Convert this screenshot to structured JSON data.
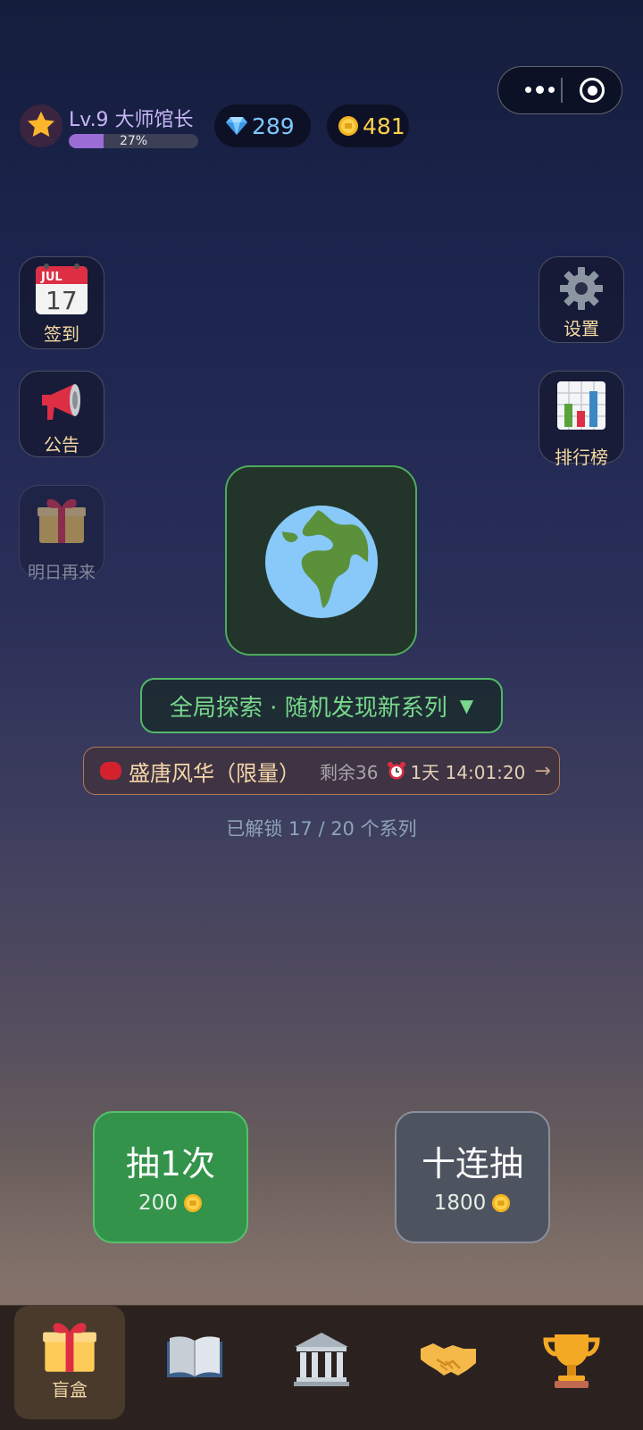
{
  "header": {
    "level_text": "Lv.9 大师馆长",
    "xp_percent_text": "27%",
    "xp_fraction": 0.27,
    "gems": "289",
    "coins": "481"
  },
  "side_left": [
    {
      "label": "签到",
      "icon": "calendar-icon",
      "calendar_month": "JUL",
      "calendar_day": "17"
    },
    {
      "label": "公告",
      "icon": "megaphone-icon"
    },
    {
      "label": "明日再来",
      "icon": "gift-icon"
    }
  ],
  "side_right": [
    {
      "label": "设置",
      "icon": "gear-icon"
    },
    {
      "label": "排行榜",
      "icon": "bar-chart-icon"
    }
  ],
  "main": {
    "explore_label": "全局探索 · 随机发现新系列",
    "limited": {
      "name": "盛唐风华（限量）",
      "remain": "剩余36",
      "time": "1天 14:01:20"
    },
    "unlocked_text": "已解锁 17 / 20 个系列"
  },
  "draw": {
    "single_label": "抽1次",
    "single_price": "200",
    "ten_label": "十连抽",
    "ten_price": "1800"
  },
  "tabbar": {
    "items": [
      {
        "label": "盲盒",
        "icon": "gift-box-icon",
        "active": true
      },
      {
        "label": "",
        "icon": "book-icon"
      },
      {
        "label": "",
        "icon": "museum-icon"
      },
      {
        "label": "",
        "icon": "handshake-icon"
      },
      {
        "label": "",
        "icon": "trophy-icon"
      }
    ]
  },
  "colors": {
    "accent_green": "#33934a",
    "explore_green": "#52b867",
    "gem_blue": "#7ec8ff",
    "coin_gold": "#ffd24d",
    "xp_purple": "#9b6cd6"
  }
}
